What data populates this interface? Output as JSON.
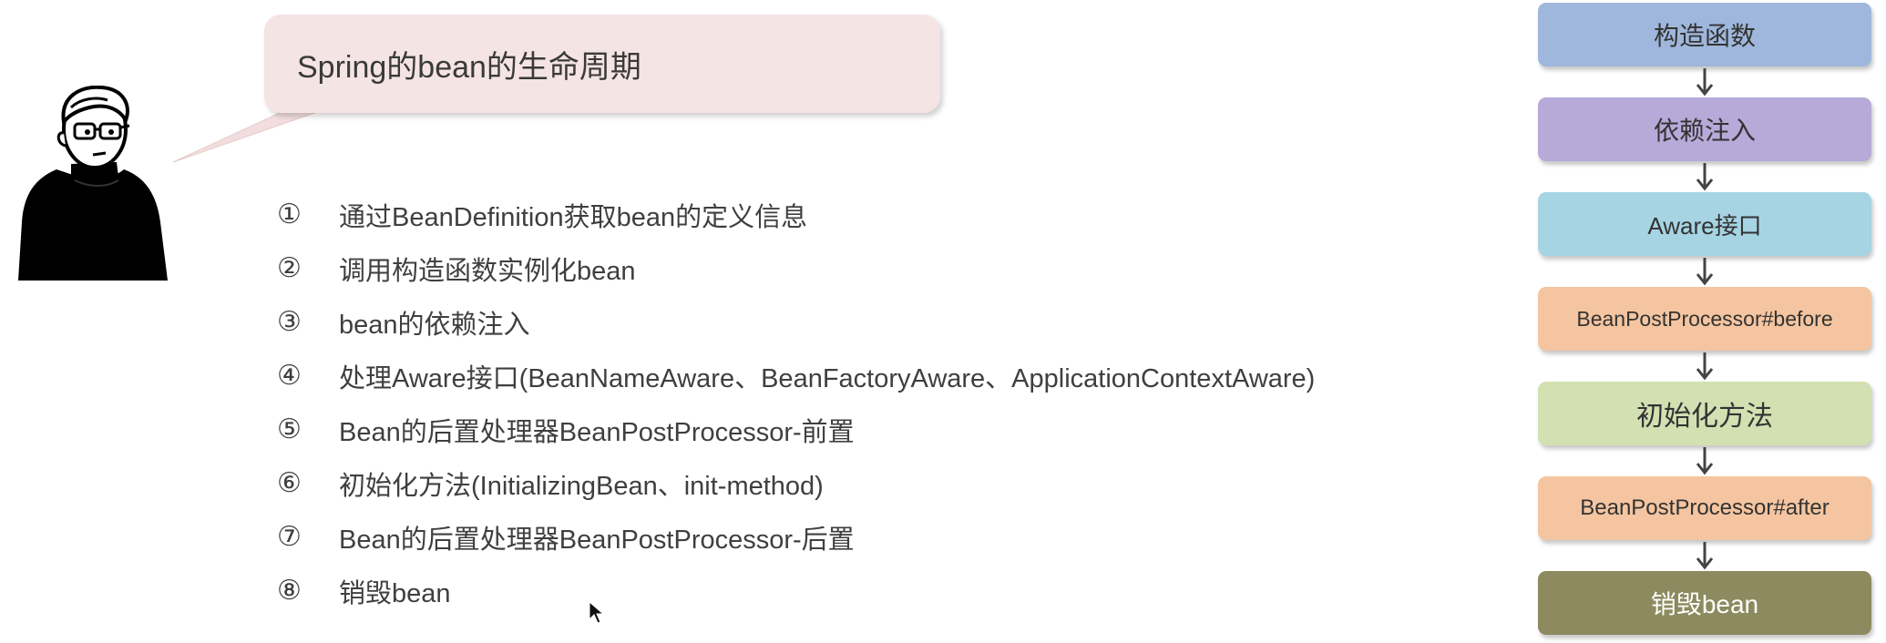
{
  "bubble": {
    "title": "Spring的bean的生命周期"
  },
  "steps": [
    {
      "num": "①",
      "text": "通过BeanDefinition获取bean的定义信息"
    },
    {
      "num": "②",
      "text": "调用构造函数实例化bean"
    },
    {
      "num": "③",
      "text": "bean的依赖注入"
    },
    {
      "num": "④",
      "text": "处理Aware接口(BeanNameAware、BeanFactoryAware、ApplicationContextAware)"
    },
    {
      "num": "⑤",
      "text": "Bean的后置处理器BeanPostProcessor-前置"
    },
    {
      "num": "⑥",
      "text": "初始化方法(InitializingBean、init-method)"
    },
    {
      "num": "⑦",
      "text": "Bean的后置处理器BeanPostProcessor-后置"
    },
    {
      "num": "⑧",
      "text": "销毁bean"
    }
  ],
  "flow": [
    {
      "label": "构造函数",
      "color": "#9fb7dc"
    },
    {
      "label": "依赖注入",
      "color": "#b7a9d8"
    },
    {
      "label": "Aware接口",
      "color": "#a6d4e3"
    },
    {
      "label": "BeanPostProcessor#before",
      "color": "#f4c5a0"
    },
    {
      "label": "初始化方法",
      "color": "#d3e0b2"
    },
    {
      "label": "BeanPostProcessor#after",
      "color": "#f4c5a0"
    },
    {
      "label": "销毁bean",
      "color": "#8c8a5e"
    }
  ]
}
